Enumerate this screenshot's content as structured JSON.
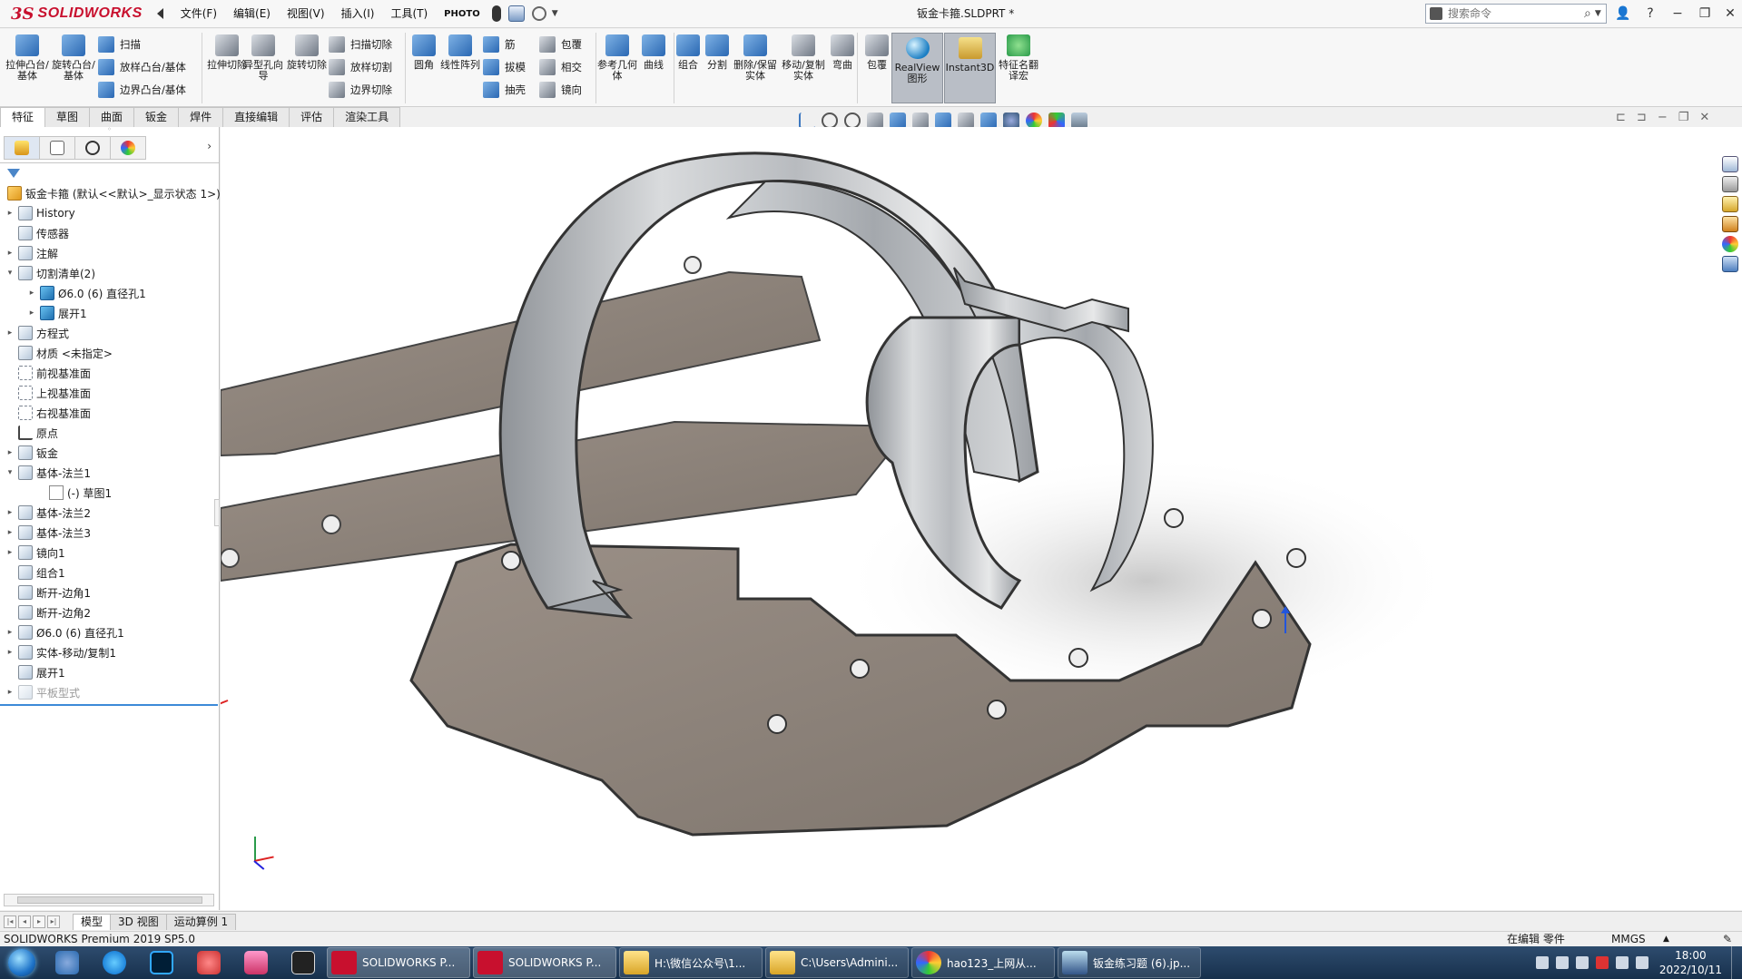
{
  "app": {
    "logo_prefix": "3S",
    "logo_text": "SOLIDWORKS"
  },
  "menu": [
    "文件(F)",
    "编辑(E)",
    "视图(V)",
    "插入(I)",
    "工具(T)",
    "PHOTO"
  ],
  "document_title": "钣金卡箍.SLDPRT *",
  "search": {
    "placeholder": "搜索命令"
  },
  "window_buttons": [
    "?",
    "−",
    "❐",
    "✕"
  ],
  "ribbon": {
    "big": [
      {
        "label": "拉伸凸台/基体"
      },
      {
        "label": "旋转凸台/基体"
      },
      {
        "label": "拉伸切除"
      },
      {
        "label": "异型孔向导"
      },
      {
        "label": "旋转切除"
      },
      {
        "label": "圆角"
      },
      {
        "label": "线性阵列"
      },
      {
        "label": "参考几何体"
      },
      {
        "label": "曲线"
      },
      {
        "label": "组合"
      },
      {
        "label": "分割"
      },
      {
        "label": "删除/保留实体"
      },
      {
        "label": "移动/复制实体"
      },
      {
        "label": "弯曲"
      },
      {
        "label": "包覆"
      },
      {
        "label": "RealView图形"
      },
      {
        "label": "Instant3D"
      },
      {
        "label": "特征名翻译宏"
      }
    ],
    "small": [
      {
        "label": "扫描"
      },
      {
        "label": "放样凸台/基体"
      },
      {
        "label": "边界凸台/基体"
      },
      {
        "label": "扫描切除"
      },
      {
        "label": "放样切割"
      },
      {
        "label": "边界切除"
      },
      {
        "label": "筋"
      },
      {
        "label": "拔模"
      },
      {
        "label": "抽壳"
      },
      {
        "label": "包覆"
      },
      {
        "label": "相交"
      },
      {
        "label": "镜向"
      }
    ]
  },
  "command_tabs": [
    "特征",
    "草图",
    "曲面",
    "钣金",
    "焊件",
    "直接编辑",
    "评估",
    "渲染工具"
  ],
  "feature_tree": {
    "root": "钣金卡箍 (默认<<默认>_显示状态 1>)",
    "items": [
      {
        "label": "History",
        "icon": "history-icon"
      },
      {
        "label": "传感器",
        "icon": "sensor-icon"
      },
      {
        "label": "注解",
        "icon": "annotation-icon"
      },
      {
        "label": "切割清单(2)",
        "icon": "cutlist-icon"
      },
      {
        "label": "Ø6.0 (6) 直径孔1",
        "icon": "body-icon"
      },
      {
        "label": "展开1",
        "icon": "body-icon"
      },
      {
        "label": "方程式",
        "icon": "equation-icon"
      },
      {
        "label": "材质 <未指定>",
        "icon": "material-icon"
      },
      {
        "label": "前视基准面",
        "icon": "plane-icon"
      },
      {
        "label": "上视基准面",
        "icon": "plane-icon"
      },
      {
        "label": "右视基准面",
        "icon": "plane-icon"
      },
      {
        "label": "原点",
        "icon": "origin-icon"
      },
      {
        "label": "钣金",
        "icon": "sheetmetal-icon"
      },
      {
        "label": "基体-法兰1",
        "icon": "base-flange-icon"
      },
      {
        "label": "(-) 草图1",
        "icon": "sketch-icon"
      },
      {
        "label": "基体-法兰2",
        "icon": "base-flange-icon"
      },
      {
        "label": "基体-法兰3",
        "icon": "base-flange-icon"
      },
      {
        "label": "镜向1",
        "icon": "mirror-icon"
      },
      {
        "label": "组合1",
        "icon": "combine-icon"
      },
      {
        "label": "断开-边角1",
        "icon": "break-corner-icon"
      },
      {
        "label": "断开-边角2",
        "icon": "break-corner-icon"
      },
      {
        "label": "Ø6.0 (6) 直径孔1",
        "icon": "hole-icon"
      },
      {
        "label": "实体-移动/复制1",
        "icon": "move-copy-icon"
      },
      {
        "label": "展开1",
        "icon": "unfold-icon"
      },
      {
        "label": "平板型式",
        "icon": "flat-pattern-icon"
      }
    ]
  },
  "model_tabs": [
    "模型",
    "3D 视图",
    "运动算例 1"
  ],
  "status": {
    "left": "SOLIDWORKS Premium 2019 SP5.0",
    "mode": "在编辑 零件",
    "units": "MMGS"
  },
  "taskbar": {
    "tasks": [
      "SOLIDWORKS P...",
      "SOLIDWORKS P...",
      "H:\\微信公众号\\1...",
      "C:\\Users\\Admini...",
      "hao123_上网从...",
      "钣金练习题 (6).jp..."
    ],
    "time": "18:00",
    "date": "2022/10/11"
  },
  "colors": {
    "accent": "#c8102e",
    "metal": "#b9bcc0",
    "flat": "#8a8077"
  }
}
